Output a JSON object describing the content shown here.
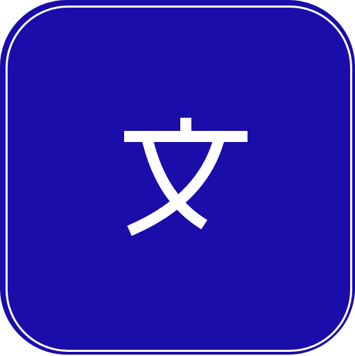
{
  "icon": {
    "name": "translate-character-icon",
    "glyph": "文",
    "colors": {
      "background": "#1a0da9",
      "border": "#ffffff",
      "glyph": "#ffffff"
    }
  }
}
